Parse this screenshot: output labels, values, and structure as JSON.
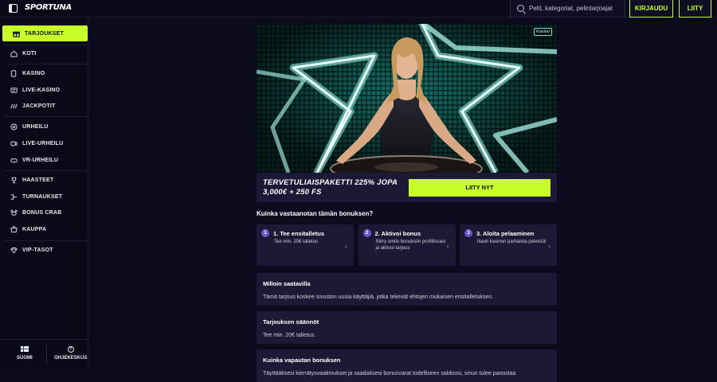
{
  "header": {
    "logo": "SPORTUNA",
    "search_placeholder": "Pelit, kategoriat, pelintarjoajat",
    "login_label": "KIRJAUDU",
    "join_label": "LIITY"
  },
  "sidebar": {
    "items": [
      {
        "label": "TARJOUKSET",
        "icon": "gift-icon",
        "active": true
      },
      {
        "label": "KOTI",
        "icon": "home-icon"
      },
      {
        "label": "KASINO",
        "icon": "cards-icon"
      },
      {
        "label": "LIVE-KASINO",
        "icon": "live-casino-icon"
      },
      {
        "label": "JACKPOTIT",
        "icon": "jackpot-icon"
      },
      {
        "label": "URHEILU",
        "icon": "ball-icon"
      },
      {
        "label": "LIVE-URHEILU",
        "icon": "live-sports-icon"
      },
      {
        "label": "VR-URHEILU",
        "icon": "gamepad-icon"
      },
      {
        "label": "HAASTEET",
        "icon": "trophy-icon"
      },
      {
        "label": "TURNAUKSET",
        "icon": "tournament-icon"
      },
      {
        "label": "BONUS CRAB",
        "icon": "crab-icon"
      },
      {
        "label": "KAUPPA",
        "icon": "shop-icon"
      },
      {
        "label": "VIP-TASOT",
        "icon": "diamond-icon"
      }
    ],
    "language_label": "SUOMI",
    "help_label": "OHJEKESKUS"
  },
  "hero": {
    "badge": "Kasino",
    "offer_line1": "TERVETULIAISPAKETTI 225% JOPA",
    "offer_line2": "3,000€ + 250 FS",
    "cta_label": "LIITY NYT"
  },
  "how_to": {
    "title": "Kuinka vastaanotan tämän bonuksen?",
    "steps": [
      {
        "num": "1",
        "title": "1. Tee ensitalletus",
        "desc": "Tee min. 20€ talletus"
      },
      {
        "num": "2",
        "title": "2. Aktivoi bonus",
        "desc": "Siirry omiin bonuksiin profiilissasi ja aktivoi tarjous"
      },
      {
        "num": "3",
        "title": "3. Aloita pelaaminen",
        "desc": "Nauti kasinon parhaista peleistä!"
      }
    ]
  },
  "cards": [
    {
      "title": "Milloin saatavilla",
      "text": "Tämä tarjous koskee sivuston uusia käyttäjiä, jotka tekevät ehtojen mukaisen ensitalletuksen."
    },
    {
      "title": "Tarjouksen säännöt",
      "text": "Tee min. 20€ talletus."
    },
    {
      "title": "Kuinka vapautan bonuksen",
      "text": "Täyttääksesi kierrätysvaatimukset ja saadaksesi bonusvarat todelliseen saldoosi, sinun tulee panostaa"
    }
  ],
  "colors": {
    "accent": "#c8ff2b",
    "background": "#0c0b1e",
    "card": "#1b1935",
    "step_badge": "#6b57c8"
  }
}
